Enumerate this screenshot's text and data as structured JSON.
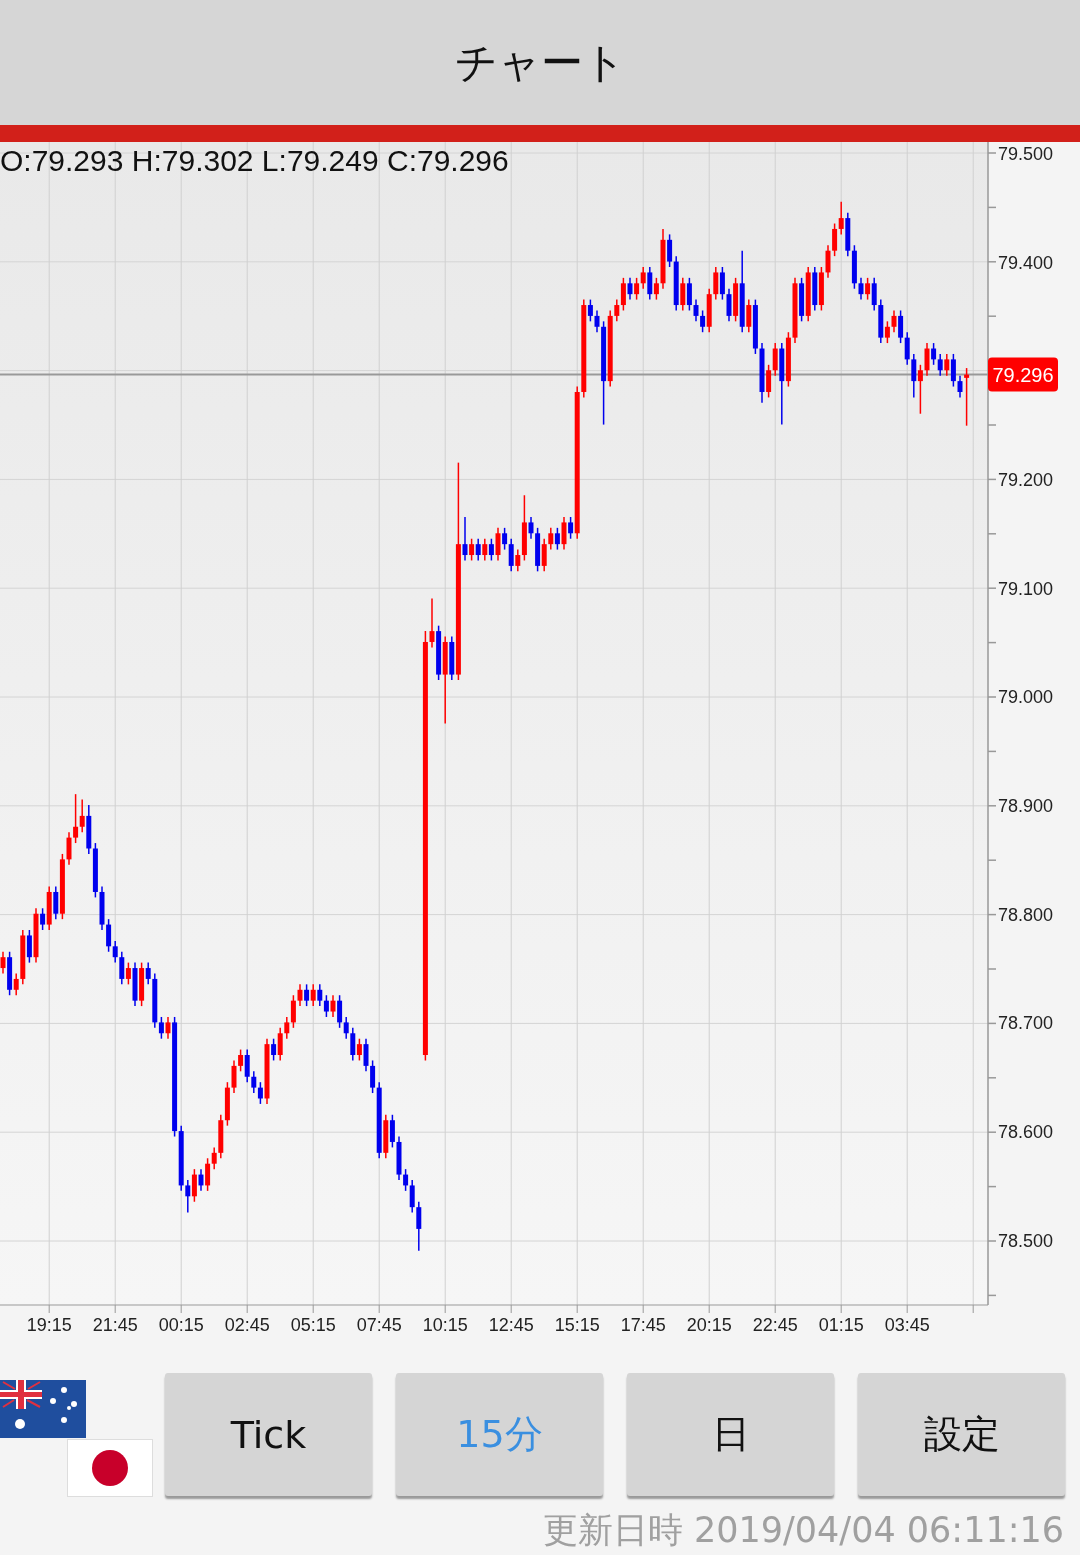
{
  "header": {
    "title": "チャート"
  },
  "chart": {
    "readout": "O:79.293 H:79.302 L:79.249 C:79.296",
    "current_price": "79.296",
    "chart_data": {
      "type": "candlestick",
      "categories": [
        null,
        null,
        null,
        null,
        null,
        null,
        null,
        "19:15",
        null,
        null,
        null,
        null,
        null,
        null,
        null,
        null,
        null,
        "21:45",
        null,
        null,
        null,
        null,
        null,
        null,
        null,
        null,
        null,
        "00:15",
        null,
        null,
        null,
        null,
        null,
        null,
        null,
        null,
        null,
        "02:45",
        null,
        null,
        null,
        null,
        null,
        null,
        null,
        null,
        null,
        "05:15",
        null,
        null,
        null,
        null,
        null,
        null,
        null,
        null,
        null,
        "07:45",
        null,
        null,
        null,
        null,
        null,
        null,
        null,
        null,
        null,
        "10:15",
        null,
        null,
        null,
        null,
        null,
        null,
        null,
        null,
        null,
        "12:45",
        null,
        null,
        null,
        null,
        null,
        null,
        null,
        null,
        null,
        "15:15",
        null,
        null,
        null,
        null,
        null,
        null,
        null,
        null,
        null,
        "17:45",
        null,
        null,
        null,
        null,
        null,
        null,
        null,
        null,
        null,
        "20:15",
        null,
        null,
        null,
        null,
        null,
        null,
        null,
        null,
        null,
        "22:45",
        null,
        null,
        null,
        null,
        null,
        null,
        null,
        null,
        null,
        "01:15",
        null,
        null,
        null,
        null,
        null,
        null,
        null,
        null,
        null,
        "03:45",
        null,
        null,
        null,
        null,
        null,
        null,
        null,
        null,
        null
      ],
      "ohlc": [
        [
          78.75,
          78.765,
          78.745,
          78.76
        ],
        [
          78.76,
          78.765,
          78.725,
          78.73
        ],
        [
          78.73,
          78.745,
          78.725,
          78.74
        ],
        [
          78.74,
          78.785,
          78.735,
          78.78
        ],
        [
          78.78,
          78.785,
          78.755,
          78.76
        ],
        [
          78.76,
          78.805,
          78.755,
          78.8
        ],
        [
          78.8,
          78.805,
          78.785,
          78.79
        ],
        [
          78.79,
          78.825,
          78.785,
          78.82
        ],
        [
          78.82,
          78.825,
          78.795,
          78.8
        ],
        [
          78.8,
          78.855,
          78.795,
          78.85
        ],
        [
          78.85,
          78.875,
          78.845,
          78.87
        ],
        [
          78.87,
          78.91,
          78.865,
          78.88
        ],
        [
          78.88,
          78.905,
          78.875,
          78.89
        ],
        [
          78.89,
          78.9,
          78.855,
          78.86
        ],
        [
          78.86,
          78.865,
          78.815,
          78.82
        ],
        [
          78.82,
          78.825,
          78.785,
          78.79
        ],
        [
          78.79,
          78.795,
          78.765,
          78.77
        ],
        [
          78.77,
          78.775,
          78.755,
          78.76
        ],
        [
          78.76,
          78.765,
          78.735,
          78.74
        ],
        [
          78.74,
          78.755,
          78.735,
          78.75
        ],
        [
          78.75,
          78.755,
          78.715,
          78.72
        ],
        [
          78.72,
          78.755,
          78.715,
          78.75
        ],
        [
          78.75,
          78.755,
          78.735,
          78.74
        ],
        [
          78.74,
          78.745,
          78.695,
          78.7
        ],
        [
          78.7,
          78.705,
          78.685,
          78.69
        ],
        [
          78.69,
          78.705,
          78.685,
          78.7
        ],
        [
          78.7,
          78.705,
          78.595,
          78.6
        ],
        [
          78.6,
          78.605,
          78.545,
          78.55
        ],
        [
          78.55,
          78.555,
          78.525,
          78.54
        ],
        [
          78.54,
          78.565,
          78.535,
          78.56
        ],
        [
          78.56,
          78.565,
          78.545,
          78.55
        ],
        [
          78.55,
          78.575,
          78.545,
          78.57
        ],
        [
          78.57,
          78.585,
          78.565,
          78.58
        ],
        [
          78.58,
          78.615,
          78.575,
          78.61
        ],
        [
          78.61,
          78.645,
          78.605,
          78.64
        ],
        [
          78.64,
          78.665,
          78.635,
          78.66
        ],
        [
          78.66,
          78.675,
          78.655,
          78.67
        ],
        [
          78.67,
          78.675,
          78.645,
          78.65
        ],
        [
          78.65,
          78.655,
          78.635,
          78.64
        ],
        [
          78.64,
          78.645,
          78.625,
          78.63
        ],
        [
          78.63,
          78.685,
          78.625,
          78.68
        ],
        [
          78.68,
          78.685,
          78.665,
          78.67
        ],
        [
          78.67,
          78.695,
          78.665,
          78.69
        ],
        [
          78.69,
          78.705,
          78.685,
          78.7
        ],
        [
          78.7,
          78.725,
          78.695,
          78.72
        ],
        [
          78.72,
          78.735,
          78.715,
          78.73
        ],
        [
          78.73,
          78.735,
          78.715,
          78.72
        ],
        [
          78.72,
          78.735,
          78.715,
          78.73
        ],
        [
          78.73,
          78.735,
          78.715,
          78.72
        ],
        [
          78.72,
          78.725,
          78.705,
          78.71
        ],
        [
          78.71,
          78.725,
          78.705,
          78.72
        ],
        [
          78.72,
          78.725,
          78.695,
          78.7
        ],
        [
          78.7,
          78.705,
          78.685,
          78.69
        ],
        [
          78.69,
          78.695,
          78.665,
          78.67
        ],
        [
          78.67,
          78.685,
          78.665,
          78.68
        ],
        [
          78.68,
          78.685,
          78.655,
          78.66
        ],
        [
          78.66,
          78.665,
          78.635,
          78.64
        ],
        [
          78.64,
          78.645,
          78.575,
          78.58
        ],
        [
          78.58,
          78.615,
          78.575,
          78.61
        ],
        [
          78.61,
          78.615,
          78.585,
          78.59
        ],
        [
          78.59,
          78.595,
          78.555,
          78.56
        ],
        [
          78.56,
          78.565,
          78.545,
          78.55
        ],
        [
          78.55,
          78.555,
          78.525,
          78.53
        ],
        [
          78.53,
          78.535,
          78.49,
          78.51
        ],
        [
          78.67,
          79.06,
          78.665,
          79.05
        ],
        [
          79.05,
          79.09,
          79.045,
          79.06
        ],
        [
          79.06,
          79.065,
          79.015,
          79.02
        ],
        [
          79.02,
          79.055,
          78.975,
          79.05
        ],
        [
          79.05,
          79.055,
          79.015,
          79.02
        ],
        [
          79.02,
          79.215,
          79.015,
          79.14
        ],
        [
          79.14,
          79.165,
          79.125,
          79.13
        ],
        [
          79.13,
          79.145,
          79.125,
          79.14
        ],
        [
          79.14,
          79.145,
          79.125,
          79.13
        ],
        [
          79.13,
          79.145,
          79.125,
          79.14
        ],
        [
          79.14,
          79.145,
          79.125,
          79.13
        ],
        [
          79.13,
          79.155,
          79.125,
          79.15
        ],
        [
          79.15,
          79.155,
          79.135,
          79.14
        ],
        [
          79.14,
          79.145,
          79.115,
          79.12
        ],
        [
          79.12,
          79.135,
          79.115,
          79.13
        ],
        [
          79.13,
          79.185,
          79.125,
          79.16
        ],
        [
          79.16,
          79.165,
          79.145,
          79.15
        ],
        [
          79.15,
          79.155,
          79.115,
          79.12
        ],
        [
          79.12,
          79.145,
          79.115,
          79.14
        ],
        [
          79.14,
          79.155,
          79.135,
          79.15
        ],
        [
          79.15,
          79.155,
          79.135,
          79.14
        ],
        [
          79.14,
          79.165,
          79.135,
          79.16
        ],
        [
          79.16,
          79.165,
          79.145,
          79.15
        ],
        [
          79.15,
          79.285,
          79.145,
          79.28
        ],
        [
          79.28,
          79.365,
          79.275,
          79.36
        ],
        [
          79.36,
          79.365,
          79.345,
          79.35
        ],
        [
          79.35,
          79.355,
          79.335,
          79.34
        ],
        [
          79.34,
          79.345,
          79.25,
          79.29
        ],
        [
          79.29,
          79.355,
          79.285,
          79.35
        ],
        [
          79.35,
          79.365,
          79.345,
          79.36
        ],
        [
          79.36,
          79.385,
          79.355,
          79.38
        ],
        [
          79.38,
          79.385,
          79.365,
          79.37
        ],
        [
          79.37,
          79.385,
          79.365,
          79.38
        ],
        [
          79.38,
          79.395,
          79.375,
          79.39
        ],
        [
          79.39,
          79.395,
          79.365,
          79.37
        ],
        [
          79.37,
          79.385,
          79.365,
          79.38
        ],
        [
          79.38,
          79.43,
          79.375,
          79.42
        ],
        [
          79.42,
          79.425,
          79.395,
          79.4
        ],
        [
          79.4,
          79.405,
          79.355,
          79.36
        ],
        [
          79.36,
          79.385,
          79.355,
          79.38
        ],
        [
          79.38,
          79.385,
          79.355,
          79.36
        ],
        [
          79.36,
          79.365,
          79.345,
          79.35
        ],
        [
          79.35,
          79.355,
          79.335,
          79.34
        ],
        [
          79.34,
          79.375,
          79.335,
          79.37
        ],
        [
          79.37,
          79.395,
          79.365,
          79.39
        ],
        [
          79.39,
          79.395,
          79.365,
          79.37
        ],
        [
          79.37,
          79.375,
          79.345,
          79.35
        ],
        [
          79.35,
          79.385,
          79.345,
          79.38
        ],
        [
          79.38,
          79.41,
          79.335,
          79.34
        ],
        [
          79.34,
          79.365,
          79.335,
          79.36
        ],
        [
          79.36,
          79.365,
          79.315,
          79.32
        ],
        [
          79.32,
          79.325,
          79.27,
          79.28
        ],
        [
          79.28,
          79.305,
          79.275,
          79.3
        ],
        [
          79.3,
          79.325,
          79.295,
          79.32
        ],
        [
          79.32,
          79.325,
          79.25,
          79.29
        ],
        [
          79.29,
          79.335,
          79.285,
          79.33
        ],
        [
          79.33,
          79.385,
          79.325,
          79.38
        ],
        [
          79.38,
          79.385,
          79.345,
          79.35
        ],
        [
          79.35,
          79.395,
          79.345,
          79.39
        ],
        [
          79.39,
          79.395,
          79.355,
          79.36
        ],
        [
          79.36,
          79.395,
          79.355,
          79.39
        ],
        [
          79.39,
          79.415,
          79.385,
          79.41
        ],
        [
          79.41,
          79.435,
          79.405,
          79.43
        ],
        [
          79.43,
          79.455,
          79.425,
          79.44
        ],
        [
          79.44,
          79.445,
          79.405,
          79.41
        ],
        [
          79.41,
          79.415,
          79.375,
          79.38
        ],
        [
          79.38,
          79.385,
          79.365,
          79.37
        ],
        [
          79.37,
          79.385,
          79.365,
          79.38
        ],
        [
          79.38,
          79.385,
          79.355,
          79.36
        ],
        [
          79.36,
          79.365,
          79.325,
          79.33
        ],
        [
          79.33,
          79.345,
          79.325,
          79.34
        ],
        [
          79.34,
          79.355,
          79.335,
          79.35
        ],
        [
          79.35,
          79.355,
          79.325,
          79.33
        ],
        [
          79.33,
          79.335,
          79.305,
          79.31
        ],
        [
          79.31,
          79.315,
          79.275,
          79.29
        ],
        [
          79.29,
          79.305,
          79.26,
          79.3
        ],
        [
          79.3,
          79.325,
          79.295,
          79.32
        ],
        [
          79.32,
          79.325,
          79.305,
          79.31
        ],
        [
          79.31,
          79.315,
          79.295,
          79.3
        ],
        [
          79.3,
          79.315,
          79.295,
          79.31
        ],
        [
          79.31,
          79.315,
          79.285,
          79.29
        ],
        [
          79.29,
          79.295,
          79.275,
          79.28
        ],
        [
          79.293,
          79.302,
          79.249,
          79.296
        ]
      ],
      "ylim": [
        78.44,
        79.51
      ],
      "grid": true,
      "ref_lines": [
        {
          "axis": "y",
          "value": 79.296
        }
      ],
      "yticks": [
        {
          "value": 79.5,
          "label": "79.500"
        },
        {
          "value": 79.4,
          "label": "79.400"
        },
        {
          "value": 79.2,
          "label": "79.200"
        },
        {
          "value": 79.1,
          "label": "79.100"
        },
        {
          "value": 79.0,
          "label": "79.000"
        },
        {
          "value": 78.9,
          "label": "78.900"
        },
        {
          "value": 78.8,
          "label": "78.800"
        },
        {
          "value": 78.7,
          "label": "78.700"
        },
        {
          "value": 78.6,
          "label": "78.600"
        },
        {
          "value": 78.5,
          "label": "78.500"
        }
      ]
    }
  },
  "buttons": [
    {
      "label": "Tick",
      "selected": false
    },
    {
      "label": "15分",
      "selected": true
    },
    {
      "label": "日",
      "selected": false
    },
    {
      "label": "設定",
      "selected": false
    }
  ],
  "footer": {
    "updated": "更新日時 2019/04/04 06:11:16"
  }
}
